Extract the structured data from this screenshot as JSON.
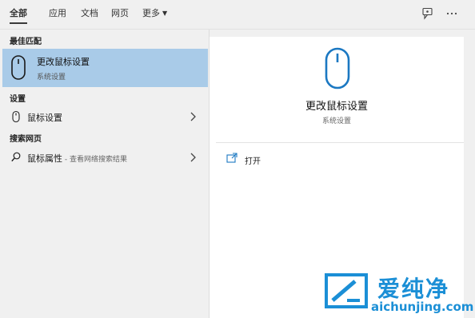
{
  "tabs": [
    {
      "label": "全部",
      "active": true
    },
    {
      "label": "应用"
    },
    {
      "label": "文档"
    },
    {
      "label": "网页"
    },
    {
      "label": "更多"
    }
  ],
  "toolbar": {
    "feedback_icon": "feedback-icon",
    "more_icon": "ellipsis-icon"
  },
  "left": {
    "best_match_heading": "最佳匹配",
    "best_match": {
      "title": "更改鼠标设置",
      "subtitle": "系统设置",
      "icon": "mouse-icon"
    },
    "settings_heading": "设置",
    "settings_item": {
      "label": "鼠标设置",
      "icon": "mouse-small-icon"
    },
    "web_heading": "搜索网页",
    "web_item": {
      "label": "鼠标属性",
      "suffix": " - 查看网络搜索结果",
      "icon": "search-icon"
    }
  },
  "right": {
    "title": "更改鼠标设置",
    "subtitle": "系统设置",
    "actions": [
      {
        "label": "打开",
        "icon": "open-icon"
      }
    ]
  },
  "watermark": {
    "brand": "爱纯净",
    "url": "aichunjing.com"
  },
  "colors": {
    "selected": "#a9cbe8",
    "accent": "#1b8fd6",
    "pane": "#f0f0f0"
  }
}
